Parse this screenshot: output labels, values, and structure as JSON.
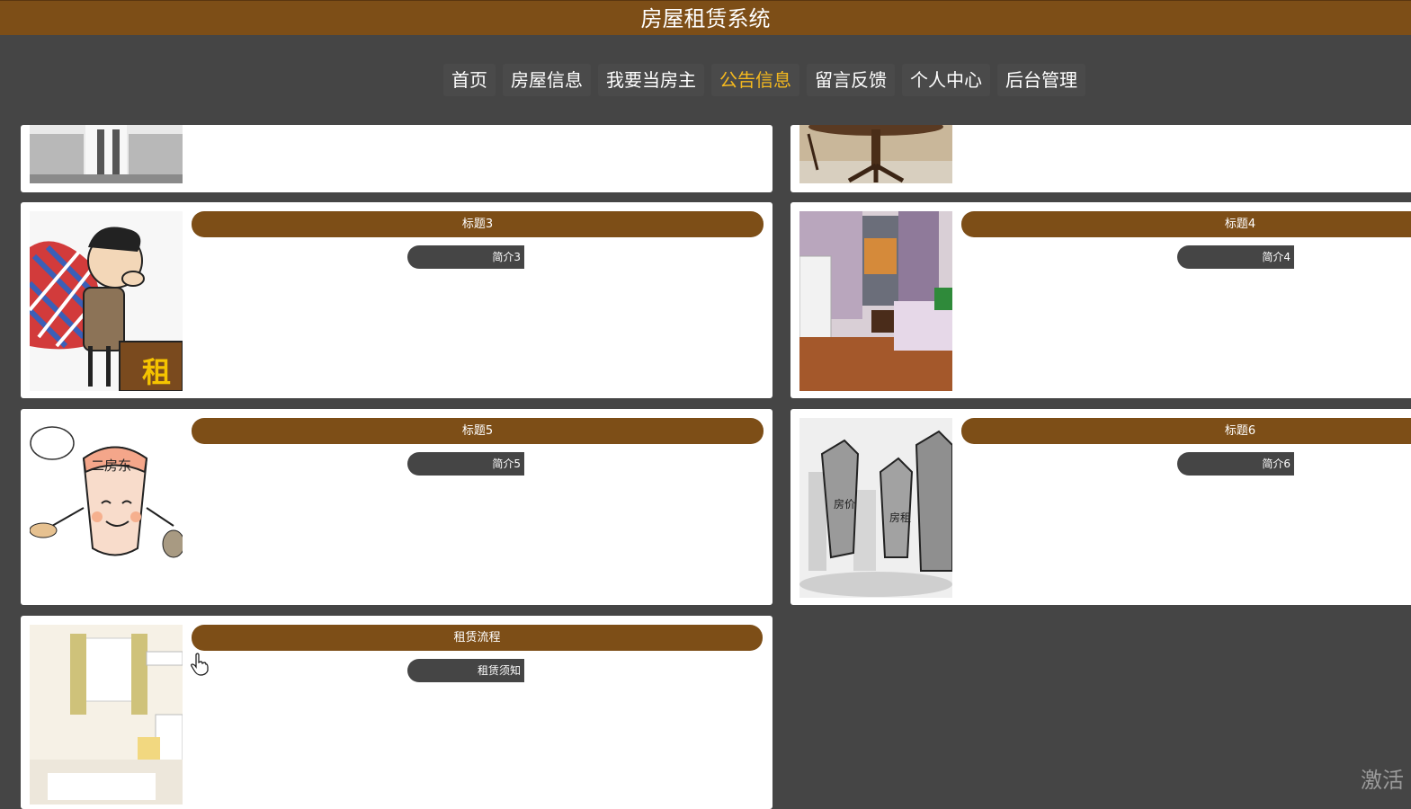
{
  "header": {
    "title": "房屋租赁系统"
  },
  "nav": {
    "items": [
      {
        "label": "首页",
        "active": false
      },
      {
        "label": "房屋信息",
        "active": false
      },
      {
        "label": "我要当房主",
        "active": false
      },
      {
        "label": "公告信息",
        "active": true
      },
      {
        "label": "留言反馈",
        "active": false
      },
      {
        "label": "个人中心",
        "active": false
      },
      {
        "label": "后台管理",
        "active": false
      }
    ]
  },
  "notices": [
    {
      "title": "标题3",
      "intro": "简介3",
      "image": "cartoon-tenant-rent-desk"
    },
    {
      "title": "标题4",
      "intro": "简介4",
      "image": "rental-bedroom"
    },
    {
      "title": "标题5",
      "intro": "简介5",
      "image": "cartoon-sublandlord"
    },
    {
      "title": "标题6",
      "intro": "简介6",
      "image": "cartoon-housing-price"
    },
    {
      "title": "租赁流程",
      "intro": "租赁须知",
      "image": "bright-room"
    }
  ],
  "partial_cards": [
    {
      "image": "kitchen-sinks"
    },
    {
      "image": "wooden-table"
    }
  ],
  "cartoon_text": {
    "rent_sign": "租",
    "sublandlord": "二房东",
    "price_tower": "房价",
    "rent_tower": "房租"
  },
  "watermark": "激活",
  "colors": {
    "brand": "#7d4e17",
    "background": "#454545",
    "active_nav": "#f5b91e",
    "card": "#ffffff"
  }
}
